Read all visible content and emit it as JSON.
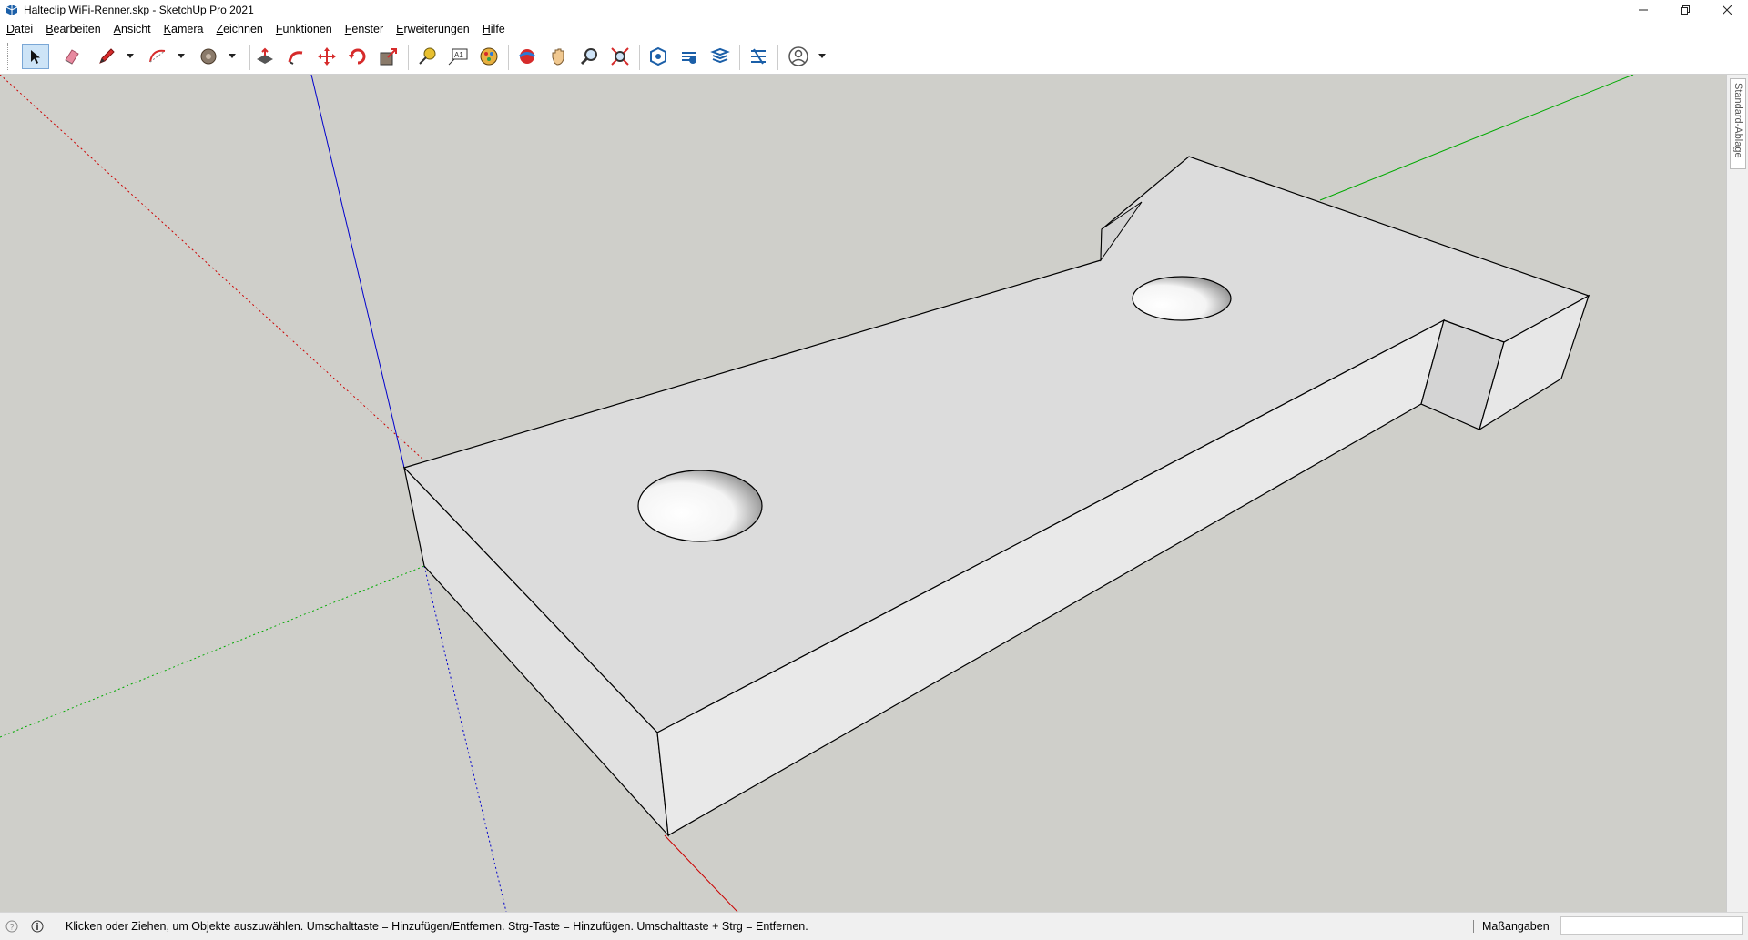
{
  "window": {
    "title": "Halteclip WiFi-Renner.skp - SketchUp Pro 2021",
    "controls": [
      "minimize",
      "restore",
      "close"
    ]
  },
  "menu": [
    {
      "label": "Datei",
      "accel": "D",
      "rest": "atei"
    },
    {
      "label": "Bearbeiten",
      "accel": "B",
      "rest": "earbeiten"
    },
    {
      "label": "Ansicht",
      "accel": "A",
      "rest": "nsicht"
    },
    {
      "label": "Kamera",
      "accel": "K",
      "rest": "amera"
    },
    {
      "label": "Zeichnen",
      "accel": "Z",
      "rest": "eichnen"
    },
    {
      "label": "Funktionen",
      "accel": "F",
      "rest": "unktionen"
    },
    {
      "label": "Fenster",
      "accel": "F",
      "rest": "enster"
    },
    {
      "label": "Erweiterungen",
      "accel": "E",
      "rest": "rweiterungen"
    },
    {
      "label": "Hilfe",
      "accel": "H",
      "rest": "ilfe"
    }
  ],
  "toolbar": {
    "tools": [
      {
        "name": "select-icon",
        "active": true
      },
      {
        "name": "eraser-icon"
      },
      {
        "name": "pencil-line-icon"
      },
      {
        "name": "arc-icon"
      },
      {
        "name": "paint-bucket-icon"
      },
      {
        "name": "push-pull-icon"
      },
      {
        "name": "follow-me-icon"
      },
      {
        "name": "move-icon"
      },
      {
        "name": "rotate-icon"
      },
      {
        "name": "scale-icon"
      },
      {
        "name": "tape-measure-icon"
      },
      {
        "name": "text-icon"
      },
      {
        "name": "materials-icon"
      },
      {
        "name": "orbit-icon"
      },
      {
        "name": "pan-icon"
      },
      {
        "name": "zoom-icon"
      },
      {
        "name": "zoom-extents-icon"
      },
      {
        "name": "warehouse-icon"
      },
      {
        "name": "extension-warehouse-icon"
      },
      {
        "name": "layout-icon"
      },
      {
        "name": "extension-manager-icon"
      },
      {
        "name": "account-icon"
      }
    ],
    "text_tool_label": "A1"
  },
  "side_tray": {
    "tab_label": "Standard-Ablage"
  },
  "status": {
    "text": "Klicken oder Ziehen, um Objekte auszuwählen. Umschalttaste = Hinzufügen/Entfernen. Strg-Taste = Hinzufügen. Umschalttaste + Strg = Entfernen.",
    "measurements_label": "Maßangaben",
    "measurements_value": ""
  },
  "colors": {
    "viewport_bg": "#cfcfca",
    "face_top": "#dcdcdc",
    "face_side": "#e6e6e6",
    "axis_red": "#cc0000",
    "axis_green": "#00aa00",
    "axis_blue": "#0000cc"
  }
}
